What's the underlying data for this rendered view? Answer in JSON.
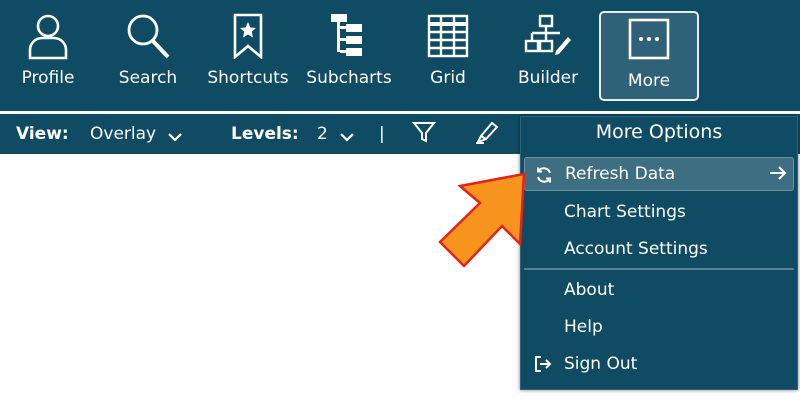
{
  "nav": {
    "profile": "Profile",
    "search": "Search",
    "shortcuts": "Shortcuts",
    "subcharts": "Subcharts",
    "grid": "Grid",
    "builder": "Builder",
    "more": "More"
  },
  "toolbar": {
    "view_label": "View:",
    "view_value": "Overlay",
    "levels_label": "Levels:",
    "levels_value": "2",
    "divider": "|"
  },
  "menu": {
    "title": "More Options",
    "items": [
      {
        "label": "Refresh Data",
        "icon": "refresh-icon",
        "highlighted": true
      },
      {
        "label": "Chart Settings"
      },
      {
        "label": "Account Settings"
      },
      {
        "label": "About"
      },
      {
        "label": "Help"
      },
      {
        "label": "Sign Out",
        "icon": "sign-out-icon"
      }
    ]
  },
  "colors": {
    "bar": "#0f4c64",
    "active": "#2f6278",
    "highlight": "#3e6e82",
    "pointer": "#f7941d",
    "pointer_border": "#e2231a"
  }
}
